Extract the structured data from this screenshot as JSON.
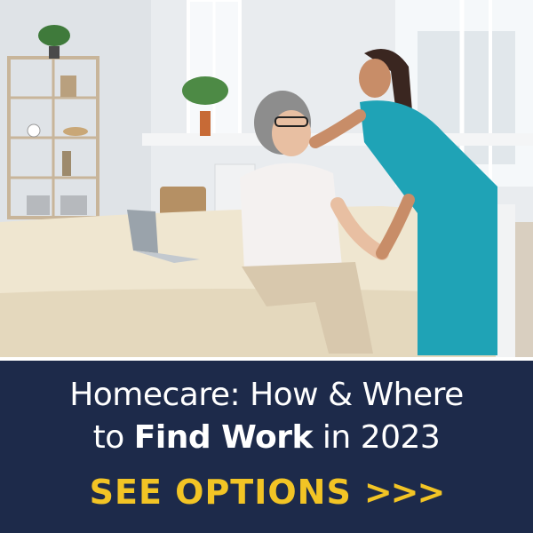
{
  "banner": {
    "line1": "Homecare: How & Where",
    "line2_prefix": "to ",
    "line2_bold": "Find Work",
    "line2_suffix": " in 2023",
    "cta_label": "SEE OPTIONS",
    "cta_arrows": ">>>"
  },
  "colors": {
    "banner_background": "#1d2a4a",
    "headline_text": "#ffffff",
    "cta_text": "#f2c425",
    "scrubs": "#1fa3b6",
    "bedspread": "#efe6d0"
  },
  "photo": {
    "scene": "nurse-helping-elderly-woman-on-bed"
  }
}
